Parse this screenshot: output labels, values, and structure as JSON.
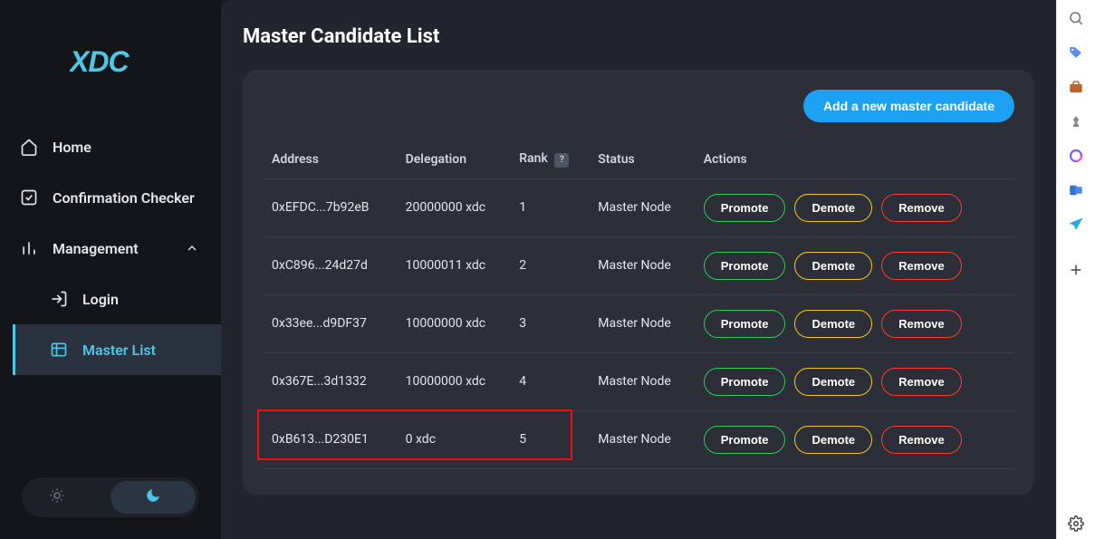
{
  "brand": "XDC",
  "sidebar": {
    "items": [
      {
        "label": "Home"
      },
      {
        "label": "Confirmation Checker"
      },
      {
        "label": "Management"
      }
    ],
    "subitems": [
      {
        "label": "Login"
      },
      {
        "label": "Master List"
      }
    ]
  },
  "page": {
    "title": "Master Candidate List",
    "add_button": "Add a new master candidate"
  },
  "table": {
    "headers": {
      "address": "Address",
      "delegation": "Delegation",
      "rank": "Rank",
      "rank_help": "?",
      "status": "Status",
      "actions": "Actions"
    },
    "action_labels": {
      "promote": "Promote",
      "demote": "Demote",
      "remove": "Remove"
    },
    "rows": [
      {
        "address": "0xEFDC...7b92eB",
        "delegation": "20000000 xdc",
        "rank": "1",
        "status": "Master Node"
      },
      {
        "address": "0xC896...24d27d",
        "delegation": "10000011 xdc",
        "rank": "2",
        "status": "Master Node"
      },
      {
        "address": "0x33ee...d9DF37",
        "delegation": "10000000 xdc",
        "rank": "3",
        "status": "Master Node"
      },
      {
        "address": "0x367E...3d1332",
        "delegation": "10000000 xdc",
        "rank": "4",
        "status": "Master Node"
      },
      {
        "address": "0xB613...D230E1",
        "delegation": "0 xdc",
        "rank": "5",
        "status": "Master Node"
      }
    ]
  },
  "rail": {
    "icons": [
      "search",
      "tag",
      "briefcase",
      "chess",
      "copilot",
      "outlook",
      "send",
      "plus",
      "settings"
    ]
  }
}
